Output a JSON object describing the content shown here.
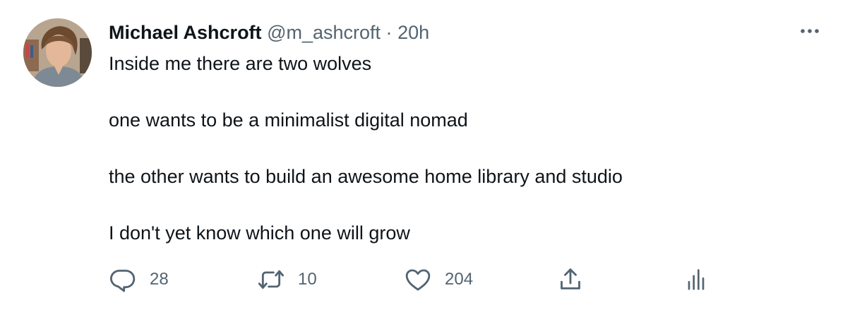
{
  "tweet": {
    "author_name": "Michael Ashcroft",
    "author_handle": "@m_ashcroft",
    "separator": "·",
    "timestamp": "20h",
    "paragraphs": [
      "Inside me there are two wolves",
      "one wants to be a minimalist digital nomad",
      "the other wants to build an awesome home library and studio",
      "I don't yet know which one will grow"
    ],
    "actions": {
      "reply": {
        "icon": "reply-icon",
        "count": "28"
      },
      "retweet": {
        "icon": "retweet-icon",
        "count": "10"
      },
      "like": {
        "icon": "heart-icon",
        "count": "204"
      },
      "share": {
        "icon": "share-icon"
      },
      "analytics": {
        "icon": "analytics-icon"
      }
    },
    "more_icon": "more-icon"
  },
  "colors": {
    "text": "#0f1419",
    "secondary": "#536471",
    "background": "#ffffff"
  }
}
